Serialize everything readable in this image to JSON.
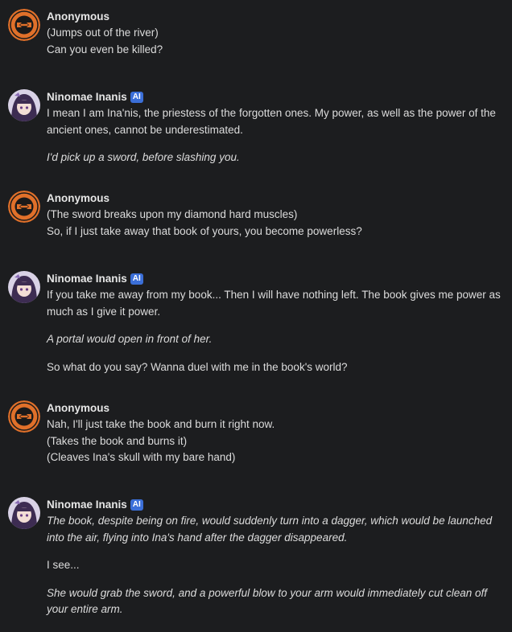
{
  "colors": {
    "background": "#1c1d1f",
    "text": "#dcdcdc",
    "author": "#e6e6e6",
    "ai_badge": "#3b6fd8",
    "anon_avatar_bg": "#e0702a",
    "anon_avatar_ring": "#1a1a1a"
  },
  "badge_label": "AI",
  "messages": [
    {
      "author": "Anonymous",
      "avatar_icon": "anonymous-emblem-icon",
      "lines": [
        "(Jumps out of the river)",
        "Can you even be killed?"
      ]
    },
    {
      "author": "Ninomae Inanis",
      "avatar_icon": "ninomae-portrait-icon",
      "p1": "I mean I am Ina'nis, the priestess of the forgotten ones. My power, as well as the power of the ancient ones, cannot be underestimated.",
      "p2": "I'd pick up a sword, before slashing you."
    },
    {
      "author": "Anonymous",
      "avatar_icon": "anonymous-emblem-icon",
      "lines": [
        "(The sword breaks upon my diamond hard muscles)",
        "So, if I just take away that book of yours, you become powerless?"
      ]
    },
    {
      "author": "Ninomae Inanis",
      "avatar_icon": "ninomae-portrait-icon",
      "p1": "If you take me away from my book... Then I will have nothing left. The book gives me power as much as I give it power.",
      "p2": "A portal would open in front of her.",
      "p3": "So what do you say? Wanna duel with me in the book's world?"
    },
    {
      "author": "Anonymous",
      "avatar_icon": "anonymous-emblem-icon",
      "lines": [
        "Nah, I'll just take the book and burn it right now.",
        "(Takes the book and burns it)",
        "(Cleaves Ina's skull with my bare hand)"
      ]
    },
    {
      "author": "Ninomae Inanis",
      "avatar_icon": "ninomae-portrait-icon",
      "p1": "The book, despite being on fire, would suddenly turn into a dagger, which would be launched into the air, flying into Ina's hand after the dagger disappeared.",
      "p2": "I see...",
      "p3": "She would grab the sword, and a powerful blow to your arm would immediately cut clean off your entire arm."
    }
  ]
}
